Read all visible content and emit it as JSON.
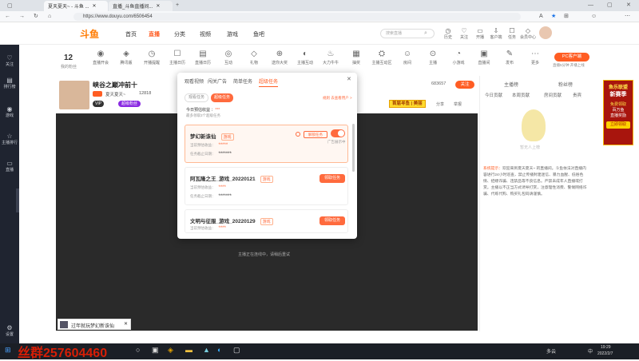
{
  "browser": {
    "tabs": [
      {
        "label": "夏天夏天~ - 斗鱼 ..."
      },
      {
        "label": "直播_斗鱼直播间..."
      }
    ],
    "url": "https://www.douyu.com/6506454"
  },
  "site": {
    "logo_text": "斗鱼",
    "nav": [
      "首页",
      "直播",
      "分类",
      "视频",
      "游戏",
      "鱼吧"
    ],
    "active_nav": "直播",
    "search_placeholder": "搜索直播",
    "top_icons": [
      "历史",
      "关注",
      "开播",
      "客户端",
      "任务",
      "会员中心"
    ]
  },
  "sidebar": {
    "items": [
      "关注",
      "排行榜",
      "游戏",
      "主播排行",
      "直播"
    ],
    "bottom_label": "设置"
  },
  "toolbar": {
    "level": "12",
    "level_label": "我的粉丝",
    "items": [
      "直播开会",
      "腾讯版",
      "开播提醒",
      "主播日历",
      "直播日历",
      "互动",
      "礼物",
      "送你大奖",
      "主播互动",
      "大力牛牛",
      "抽奖",
      "主播互动区",
      "房间",
      "主播",
      "小游戏",
      "直播间",
      "发布",
      "更多"
    ],
    "pc_button": "PC客户端",
    "pc_subtext": "直播5分钟 开播上线"
  },
  "room": {
    "title": "峡谷之巅冲前十",
    "streamer": "夏天夏天~",
    "followers": "12818",
    "follow_button": "关注",
    "badge1": "VIP",
    "badge2": "超级粉丝",
    "viewer_count": "683657",
    "banner": "首届寻鱼 | 美丽",
    "share": "分享",
    "report": "举报"
  },
  "video": {
    "status_text": "主播正在连线中，请稍后重试"
  },
  "rightpanel": {
    "tabs": [
      "主播榜",
      "粉丝榜",
      "贵宾"
    ],
    "subtabs": [
      "今日贡献",
      "本周贡献",
      "房间贡献",
      "贵宾"
    ],
    "empty_text": "暂无人上榜",
    "notice_label": "系统提示：",
    "notice": "欢迎来到夏天夏天~ 的直播间。斗鱼依法对直播内容进行24小时巡查，禁止传播封建迷信、暴力血腥、低俗色情、招嫖诈骗、违禁品等不良信息。严禁未成年人直播或打赏。主播以不正当方式诱导打赏，注意理性消费、警惕网络诈骗、代练代购、购买礼包码请谨慎。"
  },
  "ad": {
    "line1": "鱼乐联盟",
    "line2": "新赛季",
    "line3": "免费领取",
    "line4": "百万鱼",
    "line5": "直播奖励",
    "button": "立即领取"
  },
  "modal": {
    "tabs": [
      "观看视频",
      "闯关广告",
      "简单任务",
      "超级任务"
    ],
    "active_tab": "超级任务",
    "subtabs": [
      "观看任务",
      "超级任务"
    ],
    "right_link": "规则 去查看用户 >",
    "earn_text": "今日预估收益 ：",
    "earn_value": "***",
    "earn_sub": "最多领取3个超级任务",
    "cards": [
      {
        "title": "梦幻新诛仙",
        "tag": "游戏",
        "row1_label": "当前预估收益：",
        "row1_value": "*****",
        "row2_label": "任务截止日期：",
        "row2_value": "*******",
        "button": "解锁任务",
        "toggle_label": "广告展示中"
      },
      {
        "title": "阿瓦隆之王_游戏_20220121",
        "tag": "游戏",
        "row1_label": "当前预估收益：",
        "row1_value": "****",
        "row2_label": "任务截止日期：",
        "row2_value": "*******",
        "button": "领取任务"
      },
      {
        "title": "文明与征服_游戏_20220129",
        "tag": "游戏",
        "row1_label": "当前预估收益：",
        "row1_value": "****",
        "button": "领取任务"
      }
    ]
  },
  "popup": {
    "text": "过年就玩梦幻新诛仙"
  },
  "taskbar": {
    "watermark": "丝群257604460",
    "time": "19:29",
    "date": "2022/2/7",
    "lang": "中",
    "weather": "多云"
  }
}
